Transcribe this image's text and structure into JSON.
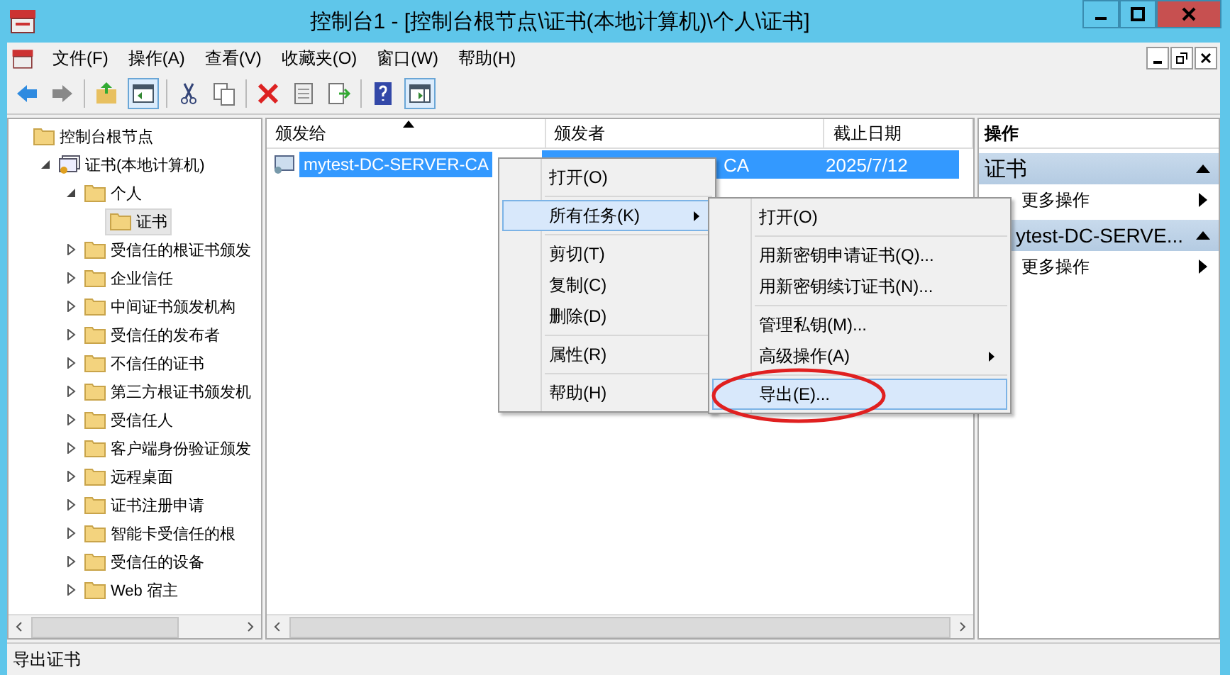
{
  "window": {
    "title": "控制台1 - [控制台根节点\\证书(本地计算机)\\个人\\证书]"
  },
  "menubar": [
    {
      "label": "文件(F)"
    },
    {
      "label": "操作(A)"
    },
    {
      "label": "查看(V)"
    },
    {
      "label": "收藏夹(O)"
    },
    {
      "label": "窗口(W)"
    },
    {
      "label": "帮助(H)"
    }
  ],
  "tree": [
    {
      "label": "控制台根节点",
      "kind": "folder",
      "selected": false,
      "children": [
        {
          "label": "证书(本地计算机)",
          "kind": "store",
          "expanded": true,
          "selected": false,
          "children": [
            {
              "label": "个人",
              "kind": "folder",
              "expanded": true,
              "selected": false,
              "children": [
                {
                  "label": "证书",
                  "kind": "folder",
                  "selected": true
                }
              ]
            },
            {
              "label": "受信任的根证书颁发",
              "kind": "folder",
              "expanded": false,
              "selected": false
            },
            {
              "label": "企业信任",
              "kind": "folder",
              "expanded": false,
              "selected": false
            },
            {
              "label": "中间证书颁发机构",
              "kind": "folder",
              "expanded": false,
              "selected": false
            },
            {
              "label": "受信任的发布者",
              "kind": "folder",
              "expanded": false,
              "selected": false
            },
            {
              "label": "不信任的证书",
              "kind": "folder",
              "expanded": false,
              "selected": false
            },
            {
              "label": "第三方根证书颁发机",
              "kind": "folder",
              "expanded": false,
              "selected": false
            },
            {
              "label": "受信任人",
              "kind": "folder",
              "expanded": false,
              "selected": false
            },
            {
              "label": "客户端身份验证颁发",
              "kind": "folder",
              "expanded": false,
              "selected": false
            },
            {
              "label": "远程桌面",
              "kind": "folder",
              "expanded": false,
              "selected": false
            },
            {
              "label": "证书注册申请",
              "kind": "folder",
              "expanded": false,
              "selected": false
            },
            {
              "label": "智能卡受信任的根",
              "kind": "folder",
              "expanded": false,
              "selected": false
            },
            {
              "label": "受信任的设备",
              "kind": "folder",
              "expanded": false,
              "selected": false
            },
            {
              "label": "Web 宿主",
              "kind": "folder",
              "expanded": false,
              "selected": false
            }
          ]
        }
      ]
    }
  ],
  "list": {
    "columns": [
      {
        "label": "颁发给",
        "sorted": true
      },
      {
        "label": "颁发者",
        "sorted": false
      },
      {
        "label": "截止日期",
        "sorted": false
      }
    ],
    "rows": [
      {
        "cells": [
          "mytest-DC-SERVER-CA",
          "CA",
          "2025/7/12"
        ],
        "selected": true
      }
    ]
  },
  "context_menu": [
    {
      "kind": "item",
      "label": "打开(O)",
      "selected": false,
      "submenu": false
    },
    {
      "kind": "separator"
    },
    {
      "kind": "item",
      "label": "所有任务(K)",
      "selected": true,
      "submenu": true
    },
    {
      "kind": "separator"
    },
    {
      "kind": "item",
      "label": "剪切(T)",
      "selected": false,
      "submenu": false
    },
    {
      "kind": "item",
      "label": "复制(C)",
      "selected": false,
      "submenu": false
    },
    {
      "kind": "item",
      "label": "删除(D)",
      "selected": false,
      "submenu": false
    },
    {
      "kind": "separator"
    },
    {
      "kind": "item",
      "label": "属性(R)",
      "selected": false,
      "submenu": false
    },
    {
      "kind": "separator"
    },
    {
      "kind": "item",
      "label": "帮助(H)",
      "selected": false,
      "submenu": false
    }
  ],
  "submenu": [
    {
      "kind": "item",
      "label": "打开(O)",
      "selected": false,
      "submenu": false
    },
    {
      "kind": "separator"
    },
    {
      "kind": "item",
      "label": "用新密钥申请证书(Q)...",
      "selected": false,
      "submenu": false
    },
    {
      "kind": "item",
      "label": "用新密钥续订证书(N)...",
      "selected": false,
      "submenu": false
    },
    {
      "kind": "separator"
    },
    {
      "kind": "item",
      "label": "管理私钥(M)...",
      "selected": false,
      "submenu": false
    },
    {
      "kind": "item",
      "label": "高级操作(A)",
      "selected": false,
      "submenu": true
    },
    {
      "kind": "separator"
    },
    {
      "kind": "item",
      "label": "导出(E)...",
      "selected": true,
      "submenu": false
    }
  ],
  "actions": {
    "title": "操作",
    "sections": [
      {
        "title": "证书",
        "items": [
          {
            "label": "更多操作"
          }
        ]
      },
      {
        "title": "ytest-DC-SERVE...",
        "items": [
          {
            "label": "更多操作"
          }
        ]
      }
    ]
  },
  "status_bar": "导出证书"
}
